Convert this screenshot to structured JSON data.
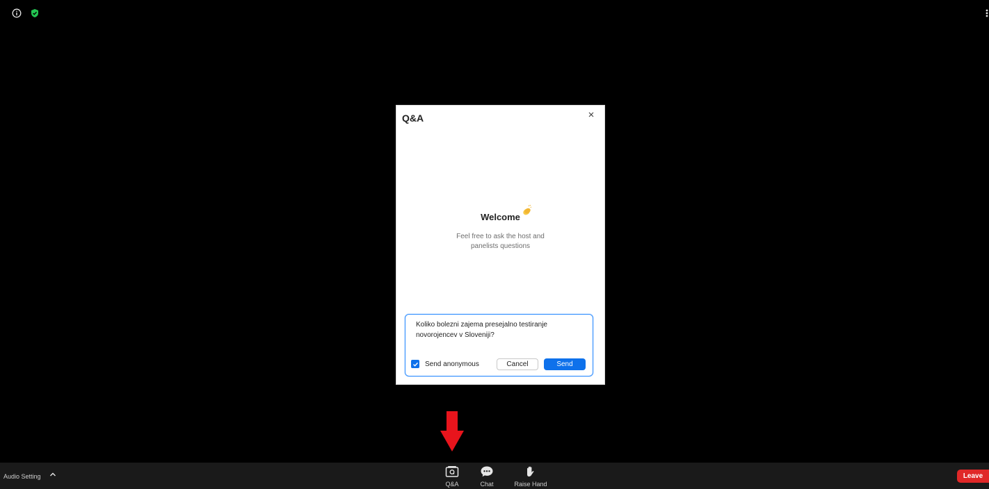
{
  "dialog": {
    "title": "Q&A",
    "welcome_title": "Welcome",
    "welcome_subtitle": "Feel free to ask the host and panelists questions",
    "question_text": "Koliko bolezni zajema presejalno testiranje novorojencev v Sloveniji?",
    "anonymous_label": "Send anonymous",
    "anonymous_checked": true,
    "cancel_label": "Cancel",
    "send_label": "Send"
  },
  "toolbar": {
    "audio_setting_label": "Audio Setting",
    "qa_label": "Q&A",
    "chat_label": "Chat",
    "raise_hand_label": "Raise Hand",
    "leave_label": "Leave"
  },
  "icons": {
    "info": "info-icon",
    "security": "shield-check-icon",
    "more": "more-vertical-icon",
    "close": "close-icon",
    "welcome_emoji": "clapping-hands-icon",
    "annotation_arrow": "red-down-arrow"
  },
  "colors": {
    "accent": "#0e71eb",
    "leave": "#e02828",
    "security": "#23c552",
    "annotation": "#e8141c"
  }
}
